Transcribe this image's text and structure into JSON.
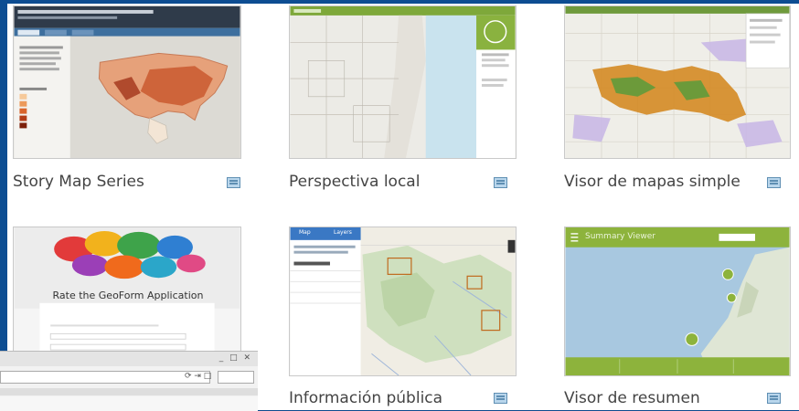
{
  "templates": [
    {
      "title": "Story Map Series",
      "icon": "template-info-icon"
    },
    {
      "title": "Perspectiva local",
      "icon": "template-info-icon"
    },
    {
      "title": "Visor de mapas simple",
      "icon": "template-info-icon"
    },
    {
      "title": "Rate the GeoForm Application",
      "icon": "template-info-icon"
    },
    {
      "title": "Información pública",
      "icon": "template-info-icon"
    },
    {
      "title": "Visor de resumen",
      "icon": "template-info-icon"
    }
  ],
  "geoform_heading": "Rate the GeoForm Application",
  "summary_viewer_header": "Summary Viewer",
  "public_info_tabs": [
    "Map",
    "Layers"
  ],
  "browser_controls": "_ □ ✕"
}
